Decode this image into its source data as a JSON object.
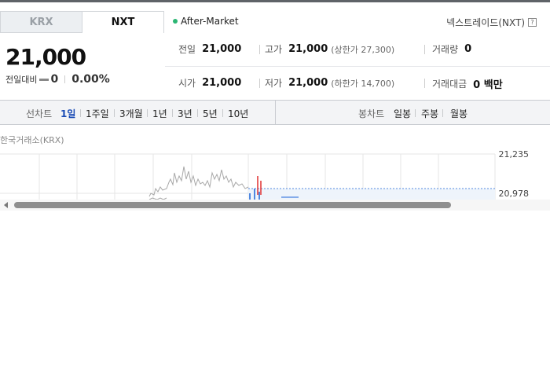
{
  "tabs": [
    {
      "label": "KRX"
    },
    {
      "label": "NXT"
    }
  ],
  "session_label": "After-Market",
  "exchange_label": "넥스트레이드(NXT)",
  "help_label": "?",
  "price": "21,000",
  "change": {
    "label": "전일대비",
    "value": "0",
    "percent": "0.00%"
  },
  "info": {
    "prev_close": {
      "label": "전일",
      "value": "21,000"
    },
    "high": {
      "label": "고가",
      "value": "21,000",
      "limit": "(상한가 27,300)"
    },
    "volume": {
      "label": "거래량",
      "value": "0"
    },
    "open": {
      "label": "시가",
      "value": "21,000"
    },
    "low": {
      "label": "저가",
      "value": "21,000",
      "limit": "(하한가 14,700)"
    },
    "turnover": {
      "label": "거래대금",
      "value": "0 백만"
    }
  },
  "line_chart": {
    "label": "선차트",
    "options": [
      "1일",
      "1주일",
      "3개월",
      "1년",
      "3년",
      "5년",
      "10년"
    ],
    "selected": "1일"
  },
  "candle_chart": {
    "label": "봉차트",
    "options": [
      "일봉",
      "주봉",
      "월봉"
    ]
  },
  "market_label": "한국거래소(KRX)",
  "y_axis": {
    "top": "21,235",
    "bottom": "20,978"
  },
  "colors": {
    "accent": "#1a4bb5",
    "session_dot": "#2bb673",
    "up": "#e03131",
    "down": "#1c64d8"
  }
}
